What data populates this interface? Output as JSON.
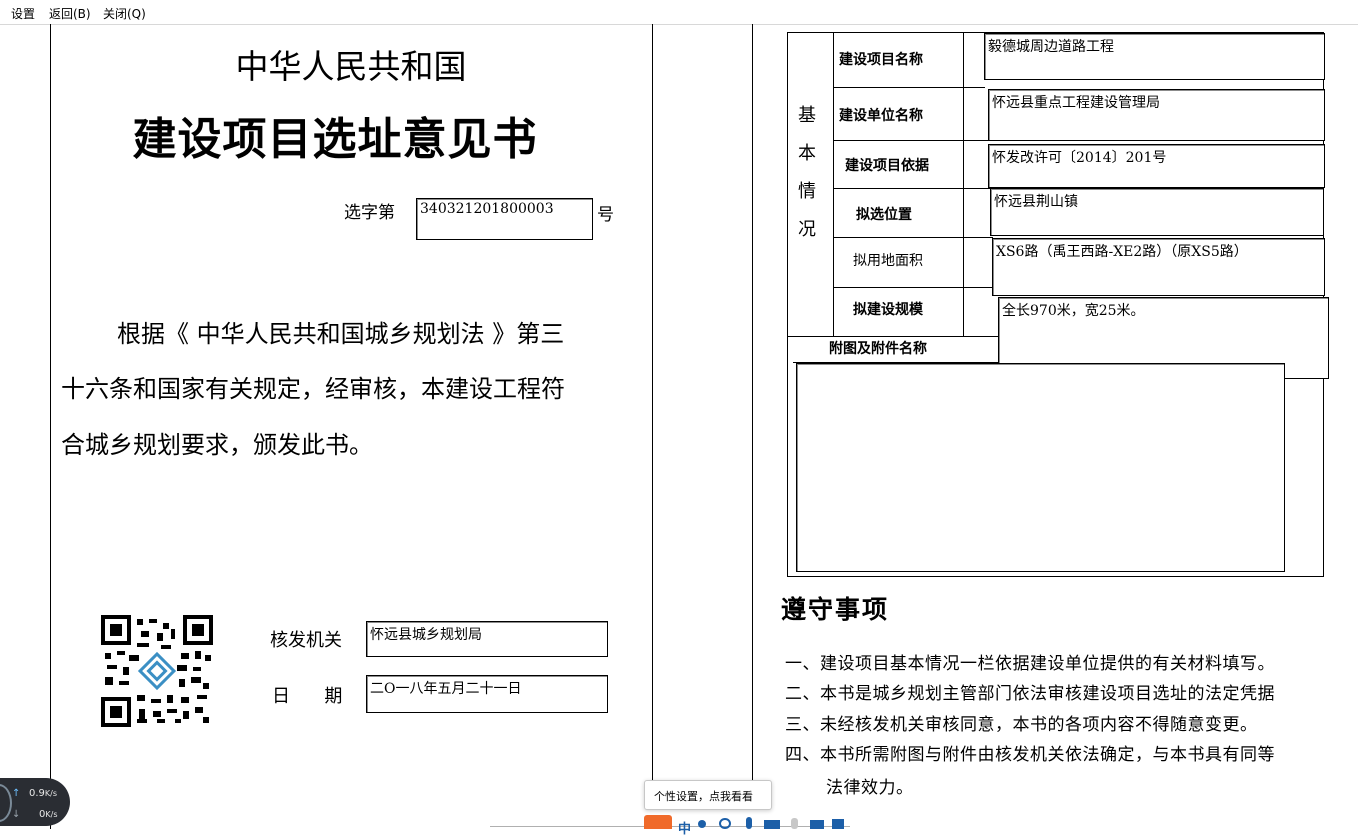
{
  "menu": {
    "settings": "设置",
    "back": "返回(B)",
    "close": "关闭(Q)"
  },
  "cert": {
    "country": "中华人民共和国",
    "title": "建设项目选址意见书",
    "number_prefix": "选字第",
    "number_value": "340321201800003",
    "number_suffix": "号",
    "body_line1": "根据《 中华人民共和国城乡规划法 》第三",
    "body_line2": "十六条和国家有关规定，经审核，本建设工程符",
    "body_line3": "合城乡规划要求，颁发此书。",
    "issuer_label": "核发机关",
    "issuer_value": "怀远县城乡规划局",
    "date_label": "日      期",
    "date_value": "二O一八年五月二十一日"
  },
  "basic": {
    "section_chars": [
      "基",
      "本",
      "情",
      "况"
    ],
    "rows": [
      {
        "label": "建设项目名称",
        "value": "毅德城周边道路工程"
      },
      {
        "label": "建设单位名称",
        "value": "怀远县重点工程建设管理局"
      },
      {
        "label": "建设项目依据",
        "value": "怀发改许可〔2014〕201号"
      },
      {
        "label": "拟选位置",
        "value": "怀远县荆山镇"
      },
      {
        "label": "拟用地面积",
        "value": "XS6路（禹王西路-XE2路）（原XS5路）"
      },
      {
        "label": "拟建设规模",
        "value": "全长970米，宽25米。"
      }
    ],
    "attachments_label": "附图及附件名称"
  },
  "notice": {
    "title": "遵守事项",
    "items": [
      "一、建设项目基本情况一栏依据建设单位提供的有关材料填写。",
      "二、本书是城乡规划主管部门依法审核建设项目选址的法定凭据",
      "三、未经核发机关审核同意，本书的各项内容不得随意变更。",
      "四、本书所需附图与附件由核发机关依法确定，与本书具有同等",
      "法律效力。"
    ]
  },
  "net_speed": {
    "up": "0.9",
    "down": "0",
    "unit": "K/s"
  },
  "tooltip": {
    "text": "个性设置，点我看看"
  },
  "ime": {
    "mode": "中"
  },
  "icons": [
    "up-arrow-icon",
    "down-arrow-icon",
    "ime-logo-icon",
    "moon-icon",
    "smiley-icon",
    "microphone-icon",
    "keyboard-icon",
    "person-icon",
    "shirt-icon",
    "grid-icon"
  ]
}
